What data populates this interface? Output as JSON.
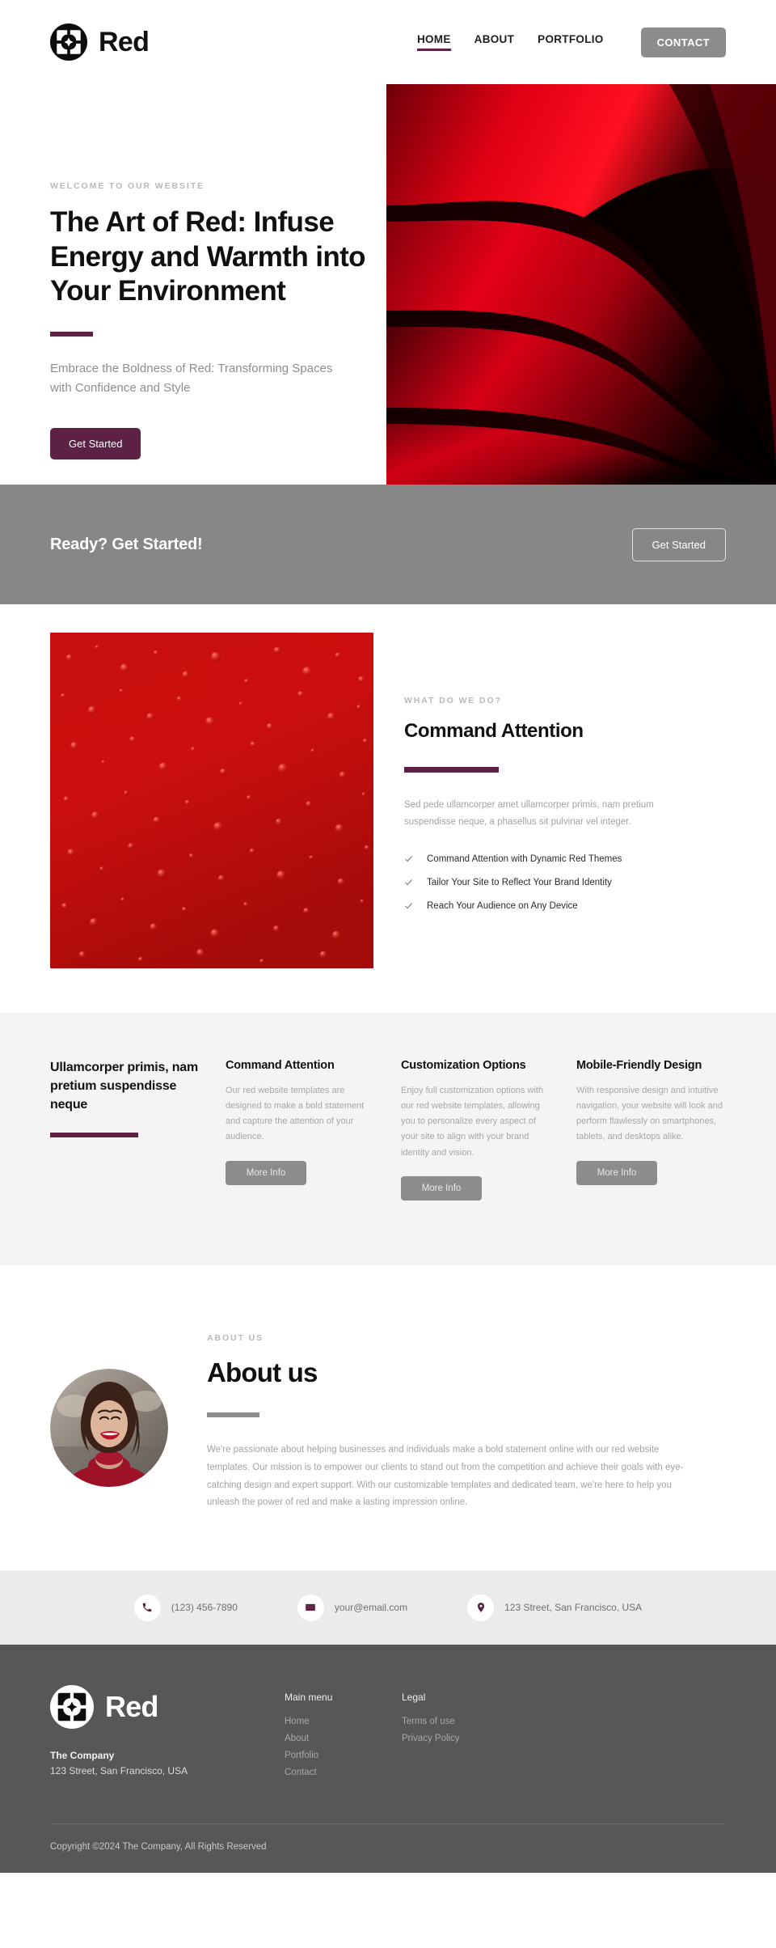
{
  "brand": {
    "name": "Red",
    "logo_icon": "flower-logo-icon"
  },
  "nav": {
    "items": [
      {
        "label": "HOME",
        "active": true
      },
      {
        "label": "ABOUT",
        "active": false
      },
      {
        "label": "PORTFOLIO",
        "active": false
      }
    ],
    "contact_label": "CONTACT"
  },
  "hero": {
    "eyebrow": "WELCOME TO OUR WEBSITE",
    "title": "The Art of Red: Infuse Energy and Warmth into Your Environment",
    "subtitle": "Embrace the Boldness of Red: Transforming Spaces with Confidence and Style",
    "cta_label": "Get Started",
    "image_alt": "abstract-red-waves-image"
  },
  "cta_bar": {
    "title": "Ready? Get Started!",
    "button_label": "Get Started"
  },
  "whatwedo": {
    "eyebrow": "WHAT DO WE DO?",
    "title": "Command Attention",
    "body": "Sed pede ullamcorper amet ullamcorper primis, nam pretium suspendisse neque, a phasellus sit pulvinar vel integer.",
    "image_alt": "red-water-droplets-image",
    "checklist": [
      "Command Attention with Dynamic Red Themes",
      "Tailor Your Site to Reflect Your Brand Identity",
      "Reach Your Audience on Any Device"
    ]
  },
  "features": {
    "lead": "Ullamcorper primis, nam pretium suspendisse neque",
    "cards": [
      {
        "title": "Command Attention",
        "body": "Our red website templates are designed to make a bold statement and capture the attention of your audience.",
        "button_label": "More Info"
      },
      {
        "title": "Customization Options",
        "body": "Enjoy full customization options with our red website templates, allowing you to personalize every aspect of your site to align with your brand identity and vision.",
        "button_label": "More Info"
      },
      {
        "title": "Mobile-Friendly Design",
        "body": "With responsive design and intuitive navigation, your website will look and perform flawlessly on smartphones, tablets, and desktops alike.",
        "button_label": "More Info"
      }
    ]
  },
  "about": {
    "eyebrow": "ABOUT US",
    "title": "About us",
    "body": "We're passionate about helping businesses and individuals make a bold statement online with our red website templates. Our mission is to empower our clients to stand out from the competition and achieve their goals with eye-catching design and expert support. With our customizable templates and dedicated team, we're here to help you unleash the power of red and make a lasting impression online.",
    "image_alt": "smiling-woman-portrait-avatar"
  },
  "contact_strip": {
    "items": [
      {
        "icon": "phone-icon",
        "text": "(123) 456-7890"
      },
      {
        "icon": "envelope-icon",
        "text": "your@email.com"
      },
      {
        "icon": "location-pin-icon",
        "text": "123 Street, San Francisco, USA"
      }
    ]
  },
  "footer": {
    "brand_name": "Red",
    "company": "The Company",
    "address": "123 Street, San Francisco, USA",
    "menu_title": "Main menu",
    "menu_links": [
      "Home",
      "About",
      "Portfolio",
      "Contact"
    ],
    "legal_title": "Legal",
    "legal_links": [
      "Terms of use",
      "Privacy Policy"
    ],
    "copyright": "Copyright ©2024 The Company, All Rights Reserved"
  },
  "colors": {
    "accent": "#5d2146",
    "grey_button": "#8c8c8c",
    "cta_bar_bg": "#878787",
    "features_bg": "#f4f4f4",
    "contact_strip_bg": "#ebebeb",
    "footer_bg": "#575757",
    "hero_red": "#d5001a"
  }
}
